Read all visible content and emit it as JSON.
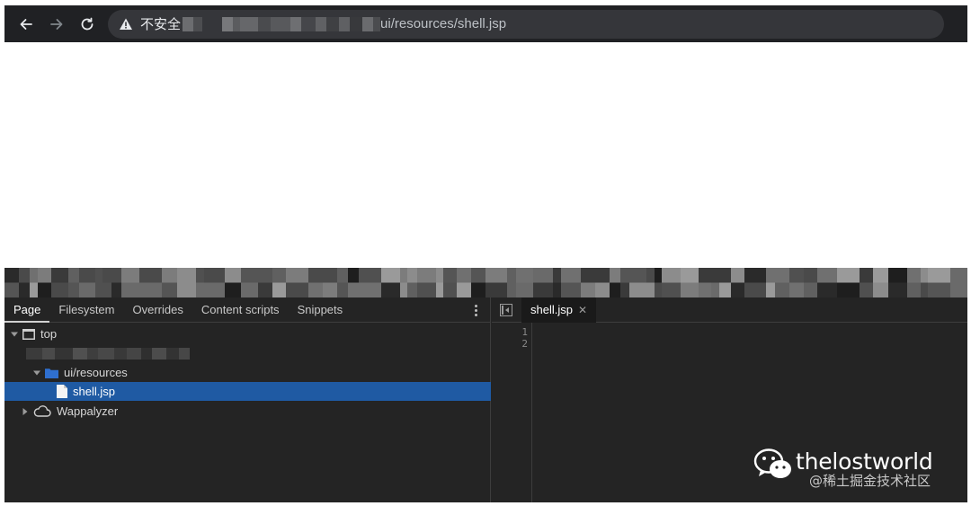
{
  "browser": {
    "security_label": "不安全",
    "url_path": "ui/resources/shell.jsp"
  },
  "devtools": {
    "sources_tabs": [
      "Page",
      "Filesystem",
      "Overrides",
      "Content scripts",
      "Snippets"
    ],
    "tree": {
      "top": "top",
      "folder": "ui/resources",
      "file": "shell.jsp",
      "extension": "Wappalyzer"
    },
    "editor": {
      "open_tab": "shell.jsp",
      "line_numbers": [
        "1",
        "2"
      ]
    }
  },
  "watermark": {
    "brand": "thelostworld",
    "sub": "@稀土掘金技术社区"
  },
  "colors": {
    "selected_row": "#1f5aa3",
    "folder_icon": "#2f6fcf"
  }
}
